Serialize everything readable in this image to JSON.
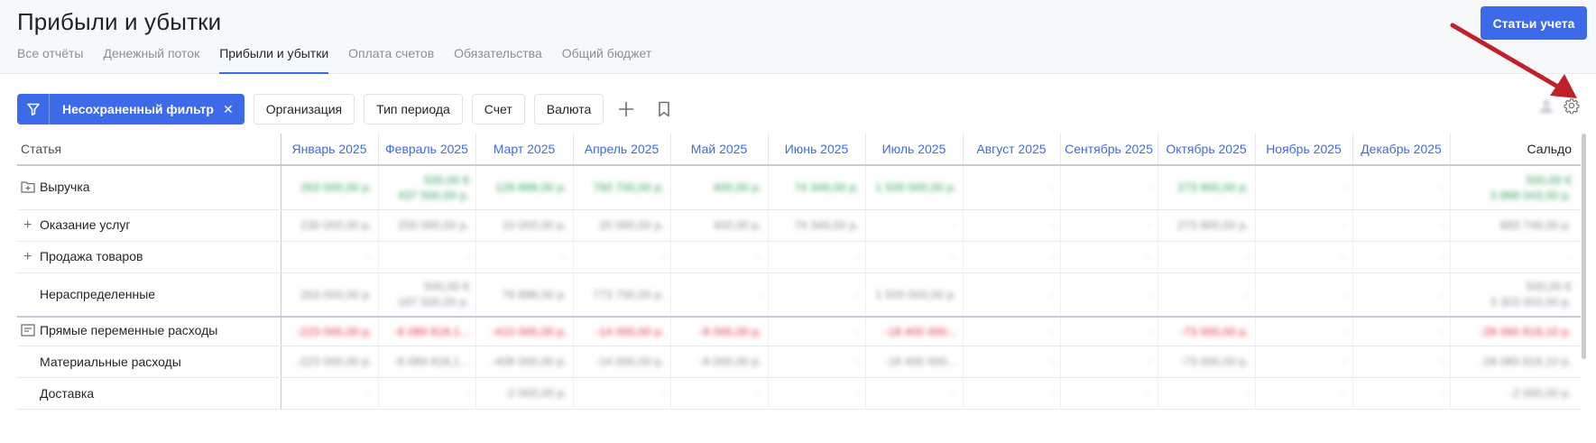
{
  "header": {
    "title": "Прибыли и убытки",
    "tabs": [
      {
        "label": "Все отчёты",
        "active": false
      },
      {
        "label": "Денежный поток",
        "active": false
      },
      {
        "label": "Прибыли и убытки",
        "active": true
      },
      {
        "label": "Оплата счетов",
        "active": false
      },
      {
        "label": "Обязательства",
        "active": false
      },
      {
        "label": "Общий бюджет",
        "active": false
      }
    ],
    "primary_button": "Статьи учета"
  },
  "toolbar": {
    "filter_chip": "Несохраненный фильтр",
    "filter_close": "✕",
    "buttons": [
      "Организация",
      "Тип периода",
      "Счет",
      "Валюта"
    ]
  },
  "table": {
    "columns": [
      "Статья",
      "Январь 2025",
      "Февраль 2025",
      "Март 2025",
      "Апрель 2025",
      "Май 2025",
      "Июнь 2025",
      "Июль 2025",
      "Август 2025",
      "Сентябрь 2025",
      "Октябрь 2025",
      "Ноябрь 2025",
      "Декабрь 2025",
      "Сальдо"
    ],
    "rows": [
      {
        "label": "Выручка",
        "kind": "group",
        "tone": "pos",
        "cells": [
          [
            "263 000,00 р."
          ],
          [
            "500,00 €",
            "437 500,00 р."
          ],
          [
            "129 888,00 р."
          ],
          [
            "793 700,00 р."
          ],
          [
            "400,00 р."
          ],
          [
            "74 349,00 р."
          ],
          [
            "1 500 000,00 р."
          ],
          [
            "-"
          ],
          [
            "-"
          ],
          [
            "273 900,00 р."
          ],
          [
            "-"
          ],
          [
            "-"
          ],
          [
            "500,00 €",
            "3 888 043,00 р."
          ]
        ]
      },
      {
        "label": "Оказание услуг",
        "kind": "expandable",
        "tone": "neu",
        "cells": [
          [
            "230 000,00 р."
          ],
          [
            "250 000,00 р."
          ],
          [
            "10 000,00 р."
          ],
          [
            "20 000,00 р."
          ],
          [
            "400,00 р."
          ],
          [
            "74 349,00 р."
          ],
          [
            "-"
          ],
          [
            "-"
          ],
          [
            "-"
          ],
          [
            "273 900,00 р."
          ],
          [
            "-"
          ],
          [
            "-"
          ],
          [
            "883 749,00 р."
          ]
        ]
      },
      {
        "label": "Продажа товаров",
        "kind": "expandable",
        "tone": "dash",
        "cells": [
          [
            "-"
          ],
          [
            "-"
          ],
          [
            "-"
          ],
          [
            "-"
          ],
          [
            "-"
          ],
          [
            "-"
          ],
          [
            "-"
          ],
          [
            "-"
          ],
          [
            "-"
          ],
          [
            "-"
          ],
          [
            "-"
          ],
          [
            "-"
          ],
          [
            "-"
          ]
        ]
      },
      {
        "label": "Нераспределенные",
        "kind": "leaf",
        "tone": "neu",
        "cells": [
          [
            "263 000,00 р."
          ],
          [
            "500,00 €",
            "187 500,00 р."
          ],
          [
            "79 888,00 р."
          ],
          [
            "773 700,00 р."
          ],
          [
            "-"
          ],
          [
            "-"
          ],
          [
            "1 500 000,00 р."
          ],
          [
            "-"
          ],
          [
            "-"
          ],
          [
            "-"
          ],
          [
            "-"
          ],
          [
            "-"
          ],
          [
            "500,00 €",
            "3 303 003,00 р."
          ]
        ]
      },
      {
        "label": "Прямые переменные расходы",
        "kind": "group",
        "tone": "neg",
        "cells": [
          [
            "-223 000,00 р."
          ],
          [
            "-8 089 818,1..."
          ],
          [
            "-410 000,00 р."
          ],
          [
            "-14 000,00 р."
          ],
          [
            "-8 000,00 р."
          ],
          [
            "-"
          ],
          [
            "-18 400 000..."
          ],
          [
            "-"
          ],
          [
            "-"
          ],
          [
            "-73 000,00 р."
          ],
          [
            "-"
          ],
          [
            "-"
          ],
          [
            "-28 060 818,10 р."
          ]
        ]
      },
      {
        "label": "Материальные расходы",
        "kind": "leaf",
        "tone": "neu",
        "cells": [
          [
            "-223 000,00 р."
          ],
          [
            "-8 089 818,1..."
          ],
          [
            "-408 000,00 р."
          ],
          [
            "-14 000,00 р."
          ],
          [
            "-8 000,00 р."
          ],
          [
            "-"
          ],
          [
            "-18 400 000..."
          ],
          [
            "-"
          ],
          [
            "-"
          ],
          [
            "-73 000,00 р."
          ],
          [
            "-"
          ],
          [
            "-"
          ],
          [
            "-28 080 818,10 р."
          ]
        ]
      },
      {
        "label": "Доставка",
        "kind": "leaf",
        "tone": "neu",
        "cells": [
          [
            "-"
          ],
          [
            "-"
          ],
          [
            "-2 000,00 р."
          ],
          [
            "-"
          ],
          [
            "-"
          ],
          [
            "-"
          ],
          [
            "-"
          ],
          [
            "-"
          ],
          [
            "-"
          ],
          [
            "-"
          ],
          [
            "-"
          ],
          [
            "-"
          ],
          [
            "-2 000,00 р."
          ]
        ]
      }
    ]
  },
  "colors": {
    "accent": "#3d6ae8",
    "positive": "#3aa35c",
    "negative": "#e2353b",
    "annotation_arrow": "#c0202a"
  },
  "icons": {
    "filter": "funnel-icon",
    "add": "plus-icon",
    "bookmark": "bookmark-icon",
    "user": "user-icon",
    "settings": "gear-icon",
    "group_revenue": "folder-icon",
    "group_expense": "list-icon"
  }
}
